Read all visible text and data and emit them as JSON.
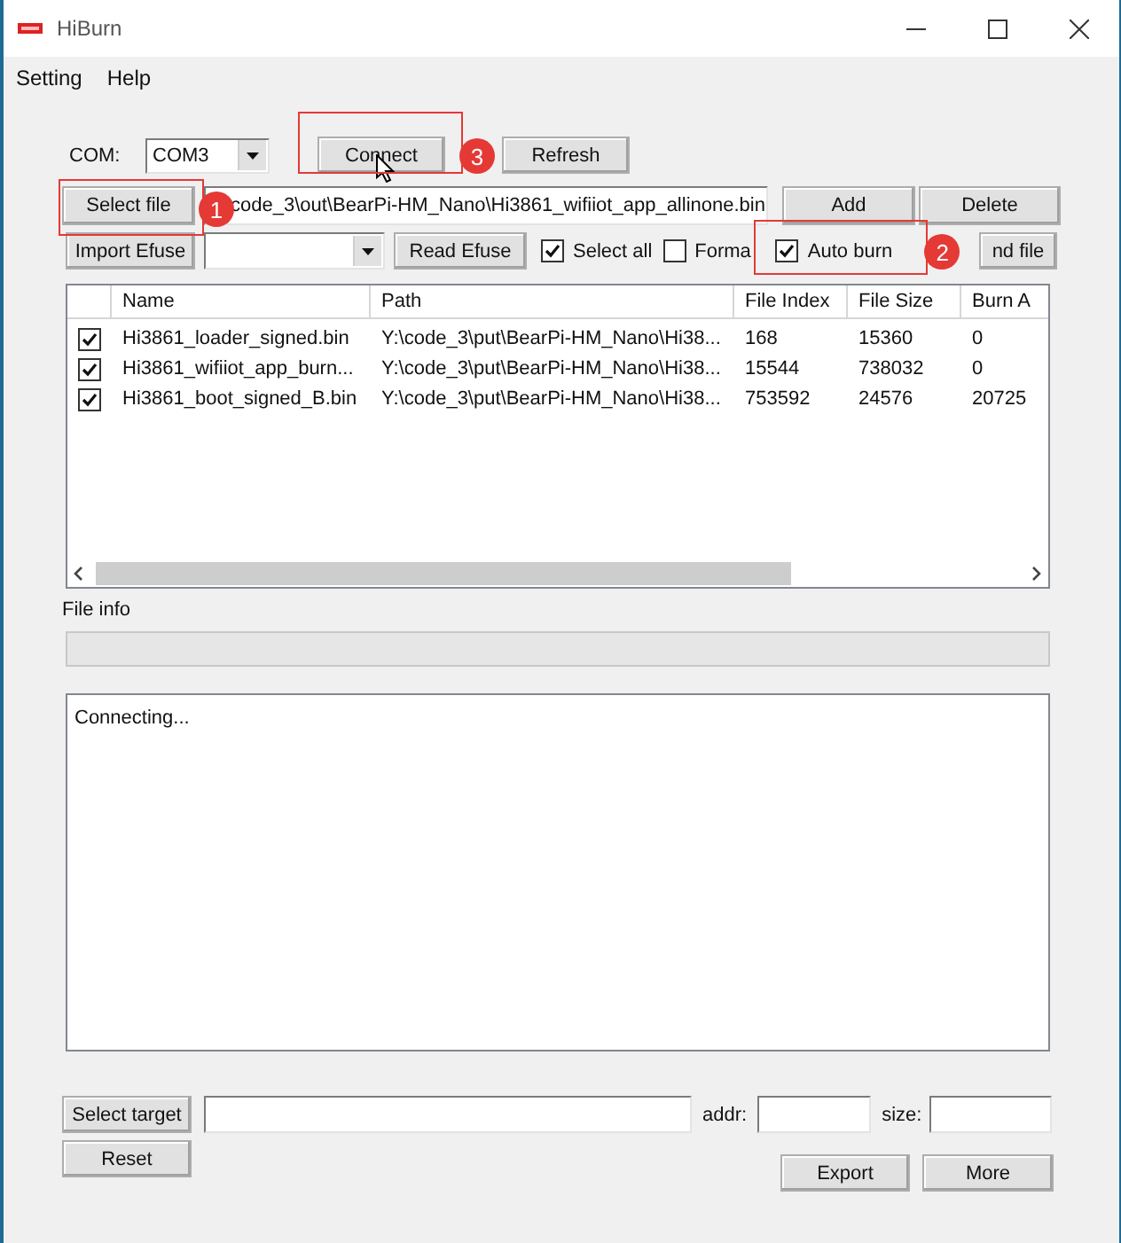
{
  "window": {
    "title": "HiBurn"
  },
  "menu": [
    {
      "label": "Setting"
    },
    {
      "label": "Help"
    }
  ],
  "connection": {
    "com_label": "COM:",
    "com_value": "COM3",
    "connect": {
      "label": "Connect",
      "callout": "3"
    },
    "refresh": {
      "label": "Refresh"
    }
  },
  "file_row": {
    "select_file": {
      "label": "Select file",
      "callout": "1"
    },
    "path": "code_3\\out\\BearPi-HM_Nano\\Hi3861_wifiiot_app_allinone.bin",
    "add": {
      "label": "Add"
    },
    "delete": {
      "label": "Delete"
    }
  },
  "efuse_row": {
    "import_efuse": {
      "label": "Import Efuse"
    },
    "read_efuse": {
      "label": "Read Efuse"
    },
    "options": [
      {
        "label": "Select all",
        "checked": true
      },
      {
        "label": "Forma",
        "checked": false
      },
      {
        "label": "Auto burn",
        "checked": true,
        "callout": "2"
      }
    ],
    "send_file": {
      "label": "nd file"
    }
  },
  "table": {
    "columns": [
      "Name",
      "Path",
      "File Index",
      "File Size",
      "Burn A"
    ],
    "rows": [
      {
        "checked": true,
        "cells": [
          "Hi3861_loader_signed.bin",
          "Y:\\code_3\\put\\BearPi-HM_Nano\\Hi38...",
          "168",
          "15360",
          "0"
        ]
      },
      {
        "checked": true,
        "cells": [
          "Hi3861_wifiiot_app_burn...",
          "Y:\\code_3\\put\\BearPi-HM_Nano\\Hi38...",
          "15544",
          "738032",
          "0"
        ]
      },
      {
        "checked": true,
        "cells": [
          "Hi3861_boot_signed_B.bin",
          "Y:\\code_3\\put\\BearPi-HM_Nano\\Hi38...",
          "753592",
          "24576",
          "20725"
        ]
      }
    ]
  },
  "file_info": {
    "label": "File info"
  },
  "log": "Connecting...",
  "target": {
    "select_target": {
      "label": "Select target"
    },
    "addr_label": "addr:",
    "size_label": "size:",
    "reset": {
      "label": "Reset"
    },
    "export": {
      "label": "Export"
    },
    "more": {
      "label": "More"
    }
  }
}
